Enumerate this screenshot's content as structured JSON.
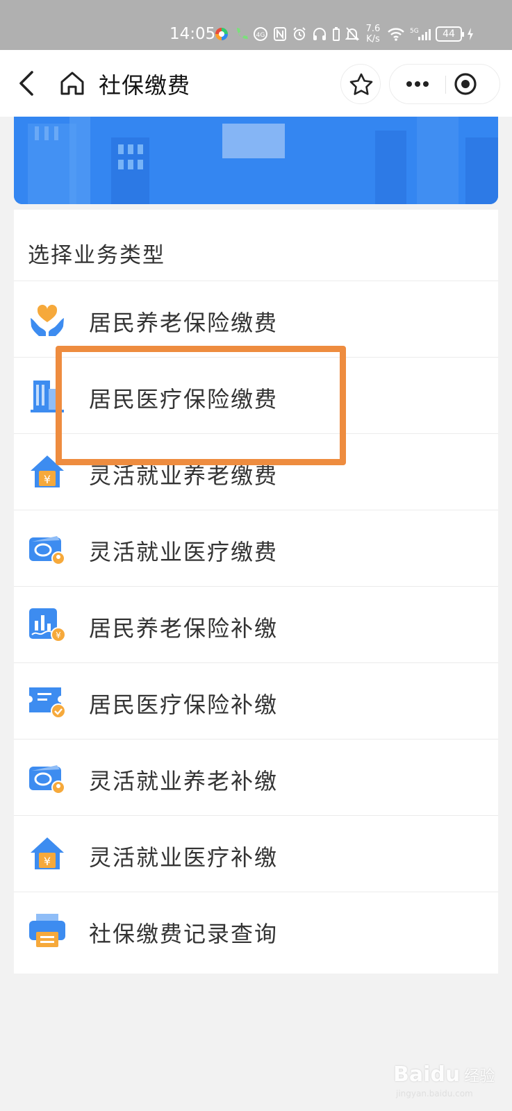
{
  "status_bar": {
    "time": "14:05",
    "net_speed_value": "7.6",
    "net_speed_unit": "K/s",
    "network": "5G",
    "battery": "44"
  },
  "nav": {
    "title": "社保缴费"
  },
  "section_title": "选择业务类型",
  "items": [
    {
      "label": "居民养老保险缴费",
      "icon": "heart-hands-icon"
    },
    {
      "label": "居民医疗保险缴费",
      "icon": "hospital-building-icon"
    },
    {
      "label": "灵活就业养老缴费",
      "icon": "house-yuan-icon"
    },
    {
      "label": "灵活就业医疗缴费",
      "icon": "social-security-card-icon"
    },
    {
      "label": "居民养老保险补缴",
      "icon": "chart-yuan-icon"
    },
    {
      "label": "居民医疗保险补缴",
      "icon": "ticket-check-icon"
    },
    {
      "label": "灵活就业养老补缴",
      "icon": "social-security-card-icon"
    },
    {
      "label": "灵活就业医疗补缴",
      "icon": "house-yuan-icon"
    },
    {
      "label": "社保缴费记录查询",
      "icon": "printer-icon"
    }
  ],
  "colors": {
    "accent_blue": "#3d8cf0",
    "highlight": "#ee8c3f",
    "orange_icon": "#f6a93b"
  },
  "watermark": {
    "brand": "Baidu",
    "sub": "经验",
    "url": "jingyan.baidu.com"
  }
}
